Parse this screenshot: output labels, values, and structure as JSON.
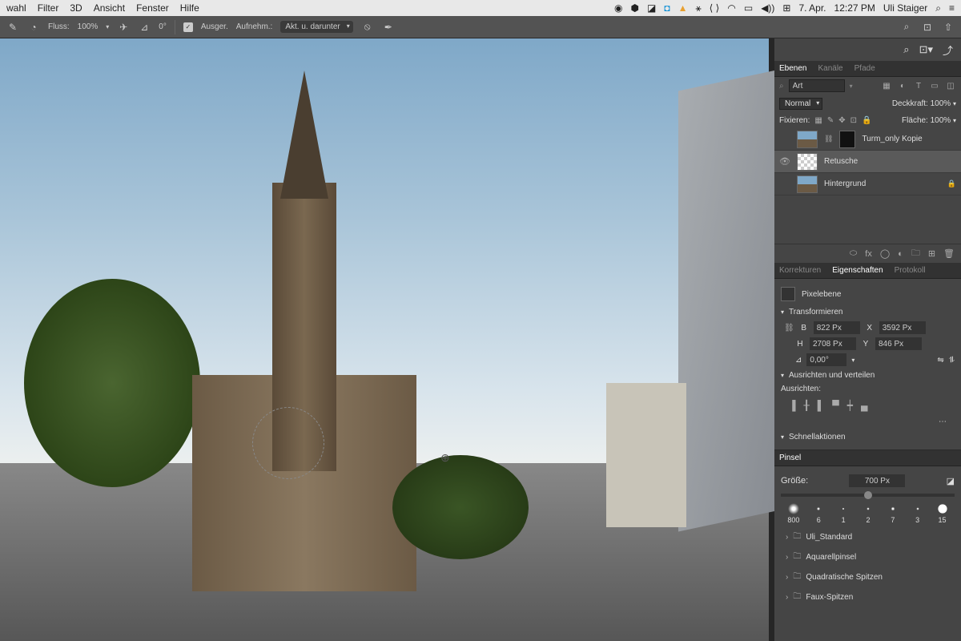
{
  "menubar": {
    "items": [
      "wahl",
      "Filter",
      "3D",
      "Ansicht",
      "Fenster",
      "Hilfe"
    ],
    "date": "7. Apr.",
    "time": "12:27 PM",
    "user": "Uli Staiger"
  },
  "optbar": {
    "fluss_label": "Fluss:",
    "fluss_value": "100%",
    "angle": "0°",
    "ausger": "Ausger.",
    "aufnehm": "Aufnehm.:",
    "sample": "Akt. u. darunter"
  },
  "panels": {
    "layers_tabs": {
      "ebenen": "Ebenen",
      "kanale": "Kanäle",
      "pfade": "Pfade"
    },
    "filter_placeholder": "Art",
    "blend": {
      "mode": "Normal",
      "opacity_label": "Deckkraft:",
      "opacity": "100%"
    },
    "lock": {
      "label": "Fixieren:",
      "fill_label": "Fläche:",
      "fill": "100%"
    },
    "layers": [
      {
        "name": "Turm_only Kopie",
        "masked": true
      },
      {
        "name": "Retusche",
        "selected": true,
        "trans": true
      },
      {
        "name": "Hintergrund",
        "locked": true
      }
    ],
    "props_tabs": {
      "korr": "Korrekturen",
      "eig": "Eigenschaften",
      "proto": "Protokoll"
    },
    "pixel_label": "Pixelebene",
    "transform": {
      "header": "Transformieren",
      "w_label": "B",
      "w": "822 Px",
      "h_label": "H",
      "h": "2708 Px",
      "x_label": "X",
      "x": "3592 Px",
      "y_label": "Y",
      "y": "846 Px",
      "angle": "0,00°"
    },
    "align": {
      "header": "Ausrichten und verteilen",
      "sub": "Ausrichten:"
    },
    "quick": "Schnellaktionen",
    "brush": {
      "tab": "Pinsel",
      "size_label": "Größe:",
      "size": "700 Px",
      "samples": [
        "800",
        "6",
        "1",
        "2",
        "7",
        "3",
        "15"
      ],
      "folders": [
        "Uli_Standard",
        "Aquarellpinsel",
        "Quadratische Spitzen",
        "Faux-Spitzen"
      ]
    }
  }
}
